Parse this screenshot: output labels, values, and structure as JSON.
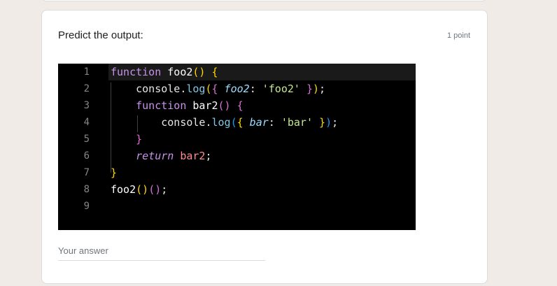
{
  "question": {
    "title": "Predict the output:",
    "points": "1 point"
  },
  "code": {
    "line_numbers": [
      "1",
      "2",
      "3",
      "4",
      "5",
      "6",
      "7",
      "8",
      "9"
    ],
    "lines": [
      [
        {
          "t": "function",
          "c": "kw"
        },
        {
          "t": " foo2",
          "c": "fn"
        },
        {
          "t": "()",
          "c": "punct"
        },
        {
          "t": " {",
          "c": "punct"
        }
      ],
      [
        {
          "t": "    console",
          "c": "plain"
        },
        {
          "t": ".",
          "c": "plain"
        },
        {
          "t": "log",
          "c": "method"
        },
        {
          "t": "(",
          "c": "punct"
        },
        {
          "t": "{",
          "c": "paren2"
        },
        {
          "t": " foo2",
          "c": "prop"
        },
        {
          "t": ":",
          "c": "plain"
        },
        {
          "t": " 'foo2'",
          "c": "str"
        },
        {
          "t": " }",
          "c": "paren2"
        },
        {
          "t": ")",
          "c": "punct"
        },
        {
          "t": ";",
          "c": "plain"
        }
      ],
      [
        {
          "t": "    function",
          "c": "kw"
        },
        {
          "t": " bar2",
          "c": "fn"
        },
        {
          "t": "()",
          "c": "paren2"
        },
        {
          "t": " {",
          "c": "paren2"
        }
      ],
      [
        {
          "t": "        console",
          "c": "plain"
        },
        {
          "t": ".",
          "c": "plain"
        },
        {
          "t": "log",
          "c": "method"
        },
        {
          "t": "(",
          "c": "paren3"
        },
        {
          "t": "{",
          "c": "punct"
        },
        {
          "t": " bar",
          "c": "prop"
        },
        {
          "t": ":",
          "c": "plain"
        },
        {
          "t": " 'bar'",
          "c": "str"
        },
        {
          "t": " }",
          "c": "punct"
        },
        {
          "t": ")",
          "c": "paren3"
        },
        {
          "t": ";",
          "c": "plain"
        }
      ],
      [
        {
          "t": "    }",
          "c": "paren2"
        }
      ],
      [
        {
          "t": "    return",
          "c": "ret"
        },
        {
          "t": " bar2",
          "c": "ident"
        },
        {
          "t": ";",
          "c": "plain"
        }
      ],
      [
        {
          "t": "}",
          "c": "punct"
        }
      ],
      [
        {
          "t": "foo2",
          "c": "fn"
        },
        {
          "t": "()",
          "c": "punct"
        },
        {
          "t": "()",
          "c": "paren2"
        },
        {
          "t": ";",
          "c": "plain"
        }
      ],
      []
    ]
  },
  "answer": {
    "placeholder": "Your answer"
  }
}
